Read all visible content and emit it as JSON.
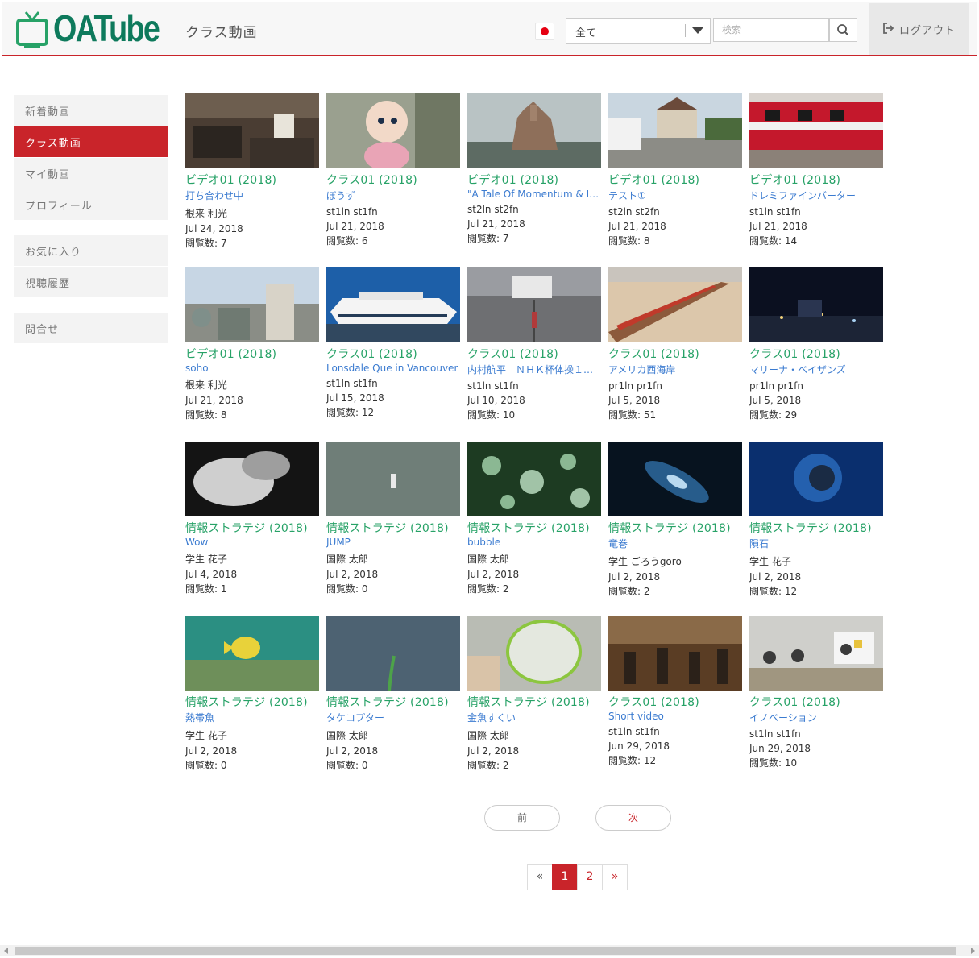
{
  "header": {
    "logo_text": "OATube",
    "page_title": "クラス動画",
    "filter_selected": "全て",
    "search_placeholder": "検索",
    "logout_label": "ログアウト",
    "brand_color": "#0e7a5c",
    "accent_color": "#c9242a"
  },
  "sidebar": {
    "items": [
      {
        "label": "新着動画",
        "active": false
      },
      {
        "label": "クラス動画",
        "active": true
      },
      {
        "label": "マイ動画",
        "active": false
      },
      {
        "label": "プロフィール",
        "active": false
      },
      {
        "label": "お気に入り",
        "active": false
      },
      {
        "label": "視聴履歴",
        "active": false
      },
      {
        "label": "問合せ",
        "active": false
      }
    ]
  },
  "videos": [
    {
      "title": "ビデオ01 (2018)",
      "subtitle": "打ち合わせ中",
      "author": "根来 利光",
      "date": "Jul 24, 2018",
      "views": "閲覧数: 7"
    },
    {
      "title": "クラス01 (2018)",
      "subtitle": "ぼうず",
      "author": "st1ln st1fn",
      "date": "Jul 21, 2018",
      "views": "閲覧数: 6"
    },
    {
      "title": "ビデオ01 (2018)",
      "subtitle": "\"A Tale Of Momentum & In…",
      "author": "st2ln st2fn",
      "date": "Jul 21, 2018",
      "views": "閲覧数: 7"
    },
    {
      "title": "ビデオ01 (2018)",
      "subtitle": "テスト①",
      "author": "st2ln st2fn",
      "date": "Jul 21, 2018",
      "views": "閲覧数: 8"
    },
    {
      "title": "ビデオ01 (2018)",
      "subtitle": "ドレミファインバーター",
      "author": "st1ln st1fn",
      "date": "Jul 21, 2018",
      "views": "閲覧数: 14"
    },
    {
      "title": "ビデオ01 (2018)",
      "subtitle": "soho",
      "author": "根来 利光",
      "date": "Jul 21, 2018",
      "views": "閲覧数: 8"
    },
    {
      "title": "クラス01 (2018)",
      "subtitle": "Lonsdale Que in Vancouver",
      "author": "st1ln st1fn",
      "date": "Jul 15, 2018",
      "views": "閲覧数: 12"
    },
    {
      "title": "クラス01 (2018)",
      "subtitle": "内村航平　ＮＨＫ杯体操１…",
      "author": "st1ln st1fn",
      "date": "Jul 10, 2018",
      "views": "閲覧数: 10"
    },
    {
      "title": "クラス01 (2018)",
      "subtitle": "アメリカ西海岸",
      "author": "pr1ln pr1fn",
      "date": "Jul 5, 2018",
      "views": "閲覧数: 51"
    },
    {
      "title": "クラス01 (2018)",
      "subtitle": "マリーナ・ベイザンズ",
      "author": "pr1ln pr1fn",
      "date": "Jul 5, 2018",
      "views": "閲覧数: 29"
    },
    {
      "title": "情報ストラテジ (2018)",
      "subtitle": "Wow",
      "author": "学生 花子",
      "date": "Jul 4, 2018",
      "views": "閲覧数: 1"
    },
    {
      "title": "情報ストラテジ (2018)",
      "subtitle": "JUMP",
      "author": "国際 太郎",
      "date": "Jul 2, 2018",
      "views": "閲覧数: 0"
    },
    {
      "title": "情報ストラテジ (2018)",
      "subtitle": "bubble",
      "author": "国際 太郎",
      "date": "Jul 2, 2018",
      "views": "閲覧数: 2"
    },
    {
      "title": "情報ストラテジ (2018)",
      "subtitle": "竜巻",
      "author": "学生 ごろうgoro",
      "date": "Jul 2, 2018",
      "views": "閲覧数: 2"
    },
    {
      "title": "情報ストラテジ (2018)",
      "subtitle": "隕石",
      "author": "学生 花子",
      "date": "Jul 2, 2018",
      "views": "閲覧数: 12"
    },
    {
      "title": "情報ストラテジ (2018)",
      "subtitle": "熱帯魚",
      "author": "学生 花子",
      "date": "Jul 2, 2018",
      "views": "閲覧数: 0"
    },
    {
      "title": "情報ストラテジ (2018)",
      "subtitle": "タケコプター",
      "author": "国際 太郎",
      "date": "Jul 2, 2018",
      "views": "閲覧数: 0"
    },
    {
      "title": "情報ストラテジ (2018)",
      "subtitle": "金魚すくい",
      "author": "国際 太郎",
      "date": "Jul 2, 2018",
      "views": "閲覧数: 2"
    },
    {
      "title": "クラス01 (2018)",
      "subtitle": "Short video",
      "author": "st1ln st1fn",
      "date": "Jun 29, 2018",
      "views": "閲覧数: 12"
    },
    {
      "title": "クラス01 (2018)",
      "subtitle": "イノベーション",
      "author": "st1ln st1fn",
      "date": "Jun 29, 2018",
      "views": "閲覧数: 10"
    }
  ],
  "pager": {
    "prev_label": "前",
    "next_label": "次"
  },
  "pagination": {
    "first": "«",
    "pages": [
      "1",
      "2"
    ],
    "current": "1",
    "last": "»"
  }
}
